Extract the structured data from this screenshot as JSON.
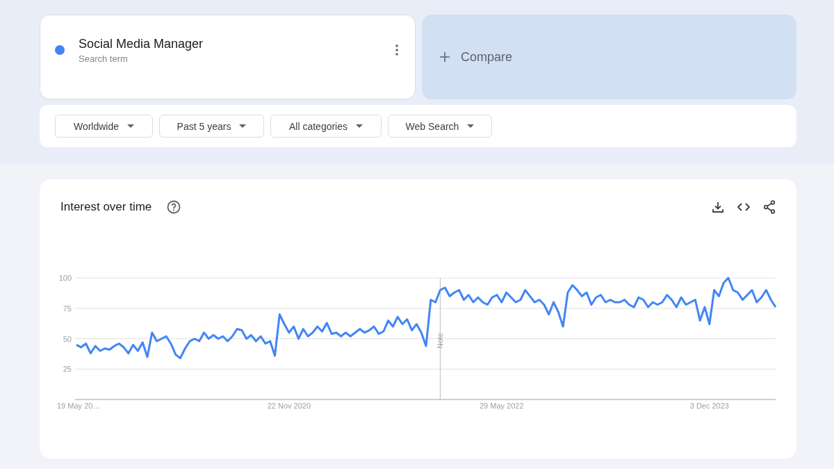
{
  "search_term": {
    "name": "Social Media Manager",
    "subtitle": "Search term",
    "color": "#4285f4"
  },
  "compare": {
    "label": "Compare"
  },
  "filters": [
    {
      "label": "Worldwide"
    },
    {
      "label": "Past 5 years"
    },
    {
      "label": "All categories"
    },
    {
      "label": "Web Search"
    }
  ],
  "interest_over_time": {
    "title": "Interest over time",
    "chart_data": {
      "type": "line",
      "grid": true,
      "ylim": [
        0,
        100
      ],
      "categories": [
        "19 May 20…",
        null,
        null,
        null,
        null,
        null,
        null,
        null,
        null,
        null,
        null,
        null,
        null,
        null,
        null,
        null,
        null,
        null,
        null,
        null,
        null,
        null,
        null,
        null,
        null,
        null,
        null,
        null,
        null,
        null,
        null,
        null,
        null,
        null,
        null,
        null,
        null,
        null,
        null,
        null,
        null,
        null,
        null,
        null,
        null,
        "22 Nov 2020",
        null,
        null,
        null,
        null,
        null,
        null,
        null,
        null,
        null,
        null,
        null,
        null,
        null,
        null,
        null,
        null,
        null,
        null,
        null,
        null,
        null,
        null,
        null,
        null,
        null,
        null,
        null,
        null,
        null,
        null,
        null,
        null,
        null,
        null,
        null,
        null,
        null,
        null,
        null,
        null,
        null,
        null,
        null,
        null,
        "29 May 2022",
        null,
        null,
        null,
        null,
        null,
        null,
        null,
        null,
        null,
        null,
        null,
        null,
        null,
        null,
        null,
        null,
        null,
        null,
        null,
        null,
        null,
        null,
        null,
        null,
        null,
        null,
        null,
        null,
        null,
        null,
        null,
        null,
        null,
        null,
        null,
        null,
        null,
        null,
        null,
        null,
        null,
        null,
        null,
        "3 Dec 2023",
        null,
        null,
        null,
        null,
        null,
        null,
        null,
        null,
        null,
        null,
        null,
        null,
        null,
        null
      ],
      "yticks": [
        25,
        50,
        75,
        100
      ],
      "annotations": [
        "Note"
      ],
      "series": [
        {
          "color": "#4285f4",
          "values": [
            45,
            43,
            46,
            38,
            44,
            40,
            42,
            41,
            44,
            46,
            43,
            38,
            45,
            40,
            47,
            35,
            55,
            48,
            50,
            52,
            46,
            37,
            34,
            42,
            48,
            50,
            48,
            55,
            50,
            53,
            50,
            52,
            48,
            52,
            58,
            57,
            50,
            53,
            48,
            52,
            46,
            48,
            36,
            70,
            62,
            55,
            60,
            50,
            58,
            52,
            55,
            60,
            56,
            63,
            54,
            55,
            52,
            55,
            52,
            55,
            58,
            55,
            57,
            60,
            54,
            56,
            65,
            60,
            68,
            62,
            66,
            57,
            62,
            55,
            44,
            82,
            80,
            90,
            92,
            85,
            88,
            90,
            82,
            86,
            80,
            84,
            80,
            78,
            84,
            86,
            80,
            88,
            84,
            80,
            82,
            90,
            85,
            80,
            82,
            78,
            70,
            80,
            72,
            60,
            88,
            94,
            90,
            85,
            88,
            78,
            84,
            86,
            80,
            82,
            80,
            80,
            82,
            78,
            76,
            84,
            82,
            76,
            80,
            78,
            80,
            86,
            82,
            76,
            84,
            78,
            80,
            82,
            65,
            76,
            62,
            90,
            85,
            96,
            100,
            90,
            88,
            82,
            86,
            90,
            80,
            84,
            90,
            82,
            76
          ]
        }
      ]
    }
  }
}
